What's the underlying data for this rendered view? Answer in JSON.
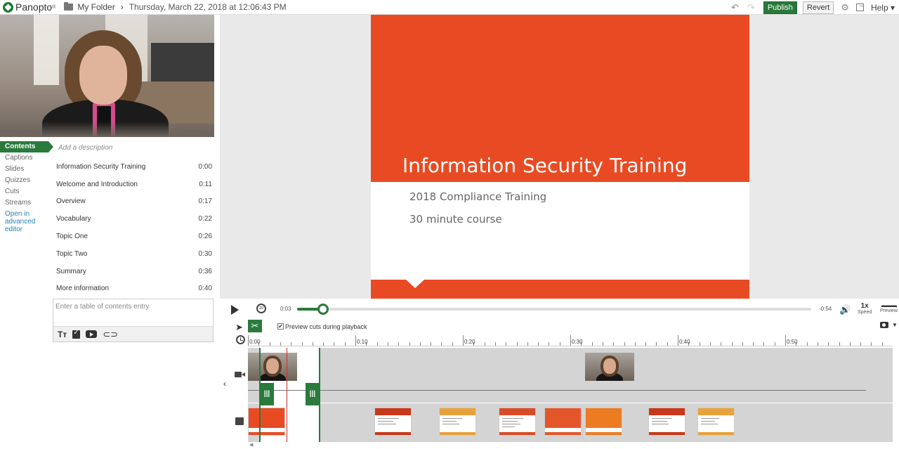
{
  "topbar": {
    "logo_text": "Panopto",
    "folder": "My Folder",
    "session_date": "Thursday, March 22, 2018 at 12:06:43 PM",
    "publish_label": "Publish",
    "revert_label": "Revert",
    "help_label": "Help"
  },
  "nav": {
    "items": [
      "Contents",
      "Captions",
      "Slides",
      "Quizzes",
      "Cuts",
      "Streams"
    ],
    "advanced_line1": "Open in",
    "advanced_line2": "advanced editor"
  },
  "contents": {
    "description_placeholder": "Add a description",
    "entries": [
      {
        "title": "Information Security Training",
        "time": "0:00"
      },
      {
        "title": "Welcome and Introduction",
        "time": "0:11"
      },
      {
        "title": "Overview",
        "time": "0:17"
      },
      {
        "title": "Vocabulary",
        "time": "0:22"
      },
      {
        "title": "Topic One",
        "time": "0:26"
      },
      {
        "title": "Topic Two",
        "time": "0:30"
      },
      {
        "title": "Summary",
        "time": "0:36"
      },
      {
        "title": "More information",
        "time": "0:40"
      }
    ],
    "entry_placeholder": "Enter a table of contents entry"
  },
  "slide": {
    "title": "Information Security Training",
    "line1": "2018 Compliance Training",
    "line2": "30 minute course",
    "accent_color": "#e84b23"
  },
  "player": {
    "elapsed": "0:03",
    "remaining": "-0:54",
    "progress": 0.05,
    "speed_value": "1x",
    "speed_label": "Speed",
    "preview_label": "Preview",
    "rewind_label": "10"
  },
  "timeline": {
    "preview_cuts_label": "Preview cuts during playback",
    "preview_cuts_checked": true,
    "ruler_labels": [
      "0:00",
      "0:10",
      "0:20",
      "0:30",
      "0:40",
      "0:50"
    ],
    "handle_label": "|||",
    "accent_color": "#2a7a3c"
  }
}
